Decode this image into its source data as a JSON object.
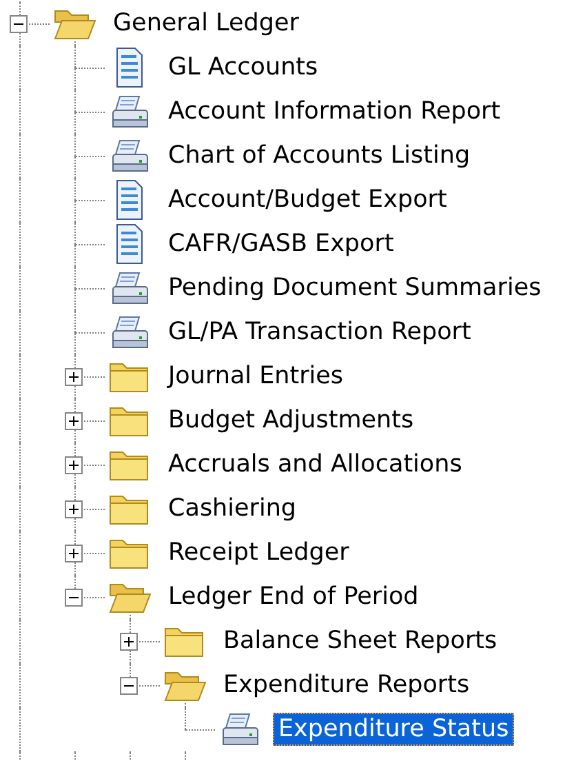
{
  "tree": [
    {
      "kind": "folder",
      "label": "General Ledger",
      "expanded": true,
      "selected": false,
      "children": [
        {
          "kind": "document",
          "label": "GL Accounts",
          "selected": false
        },
        {
          "kind": "report",
          "label": "Account Information Report",
          "selected": false
        },
        {
          "kind": "report",
          "label": "Chart of Accounts Listing",
          "selected": false
        },
        {
          "kind": "document",
          "label": "Account/Budget Export",
          "selected": false
        },
        {
          "kind": "document",
          "label": "CAFR/GASB Export",
          "selected": false
        },
        {
          "kind": "report",
          "label": "Pending Document Summaries",
          "selected": false
        },
        {
          "kind": "report",
          "label": "GL/PA Transaction Report",
          "selected": false
        },
        {
          "kind": "folder",
          "label": "Journal Entries",
          "expanded": false,
          "selected": false
        },
        {
          "kind": "folder",
          "label": "Budget Adjustments",
          "expanded": false,
          "selected": false
        },
        {
          "kind": "folder",
          "label": "Accruals and Allocations",
          "expanded": false,
          "selected": false
        },
        {
          "kind": "folder",
          "label": "Cashiering",
          "expanded": false,
          "selected": false
        },
        {
          "kind": "folder",
          "label": "Receipt Ledger",
          "expanded": false,
          "selected": false
        },
        {
          "kind": "folder",
          "label": "Ledger End of Period",
          "expanded": true,
          "selected": false,
          "children": [
            {
              "kind": "folder",
              "label": "Balance Sheet Reports",
              "expanded": false,
              "selected": false
            },
            {
              "kind": "folder",
              "label": "Expenditure Reports",
              "expanded": true,
              "selected": false,
              "children": [
                {
                  "kind": "report",
                  "label": "Expenditure Status",
                  "selected": true
                }
              ]
            }
          ]
        }
      ]
    }
  ]
}
